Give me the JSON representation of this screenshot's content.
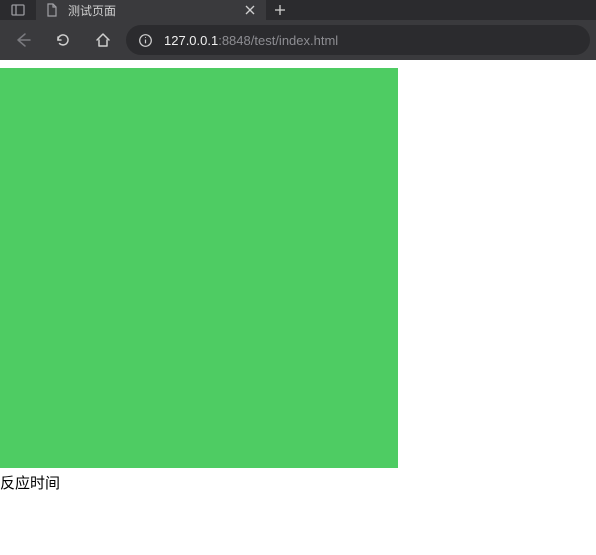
{
  "tab": {
    "title": "测试页面"
  },
  "url": {
    "host": "127.0.0.1",
    "rest": ":8848/test/index.html"
  },
  "page": {
    "label": "反应时间"
  },
  "colors": {
    "box": "#4ecc63"
  }
}
